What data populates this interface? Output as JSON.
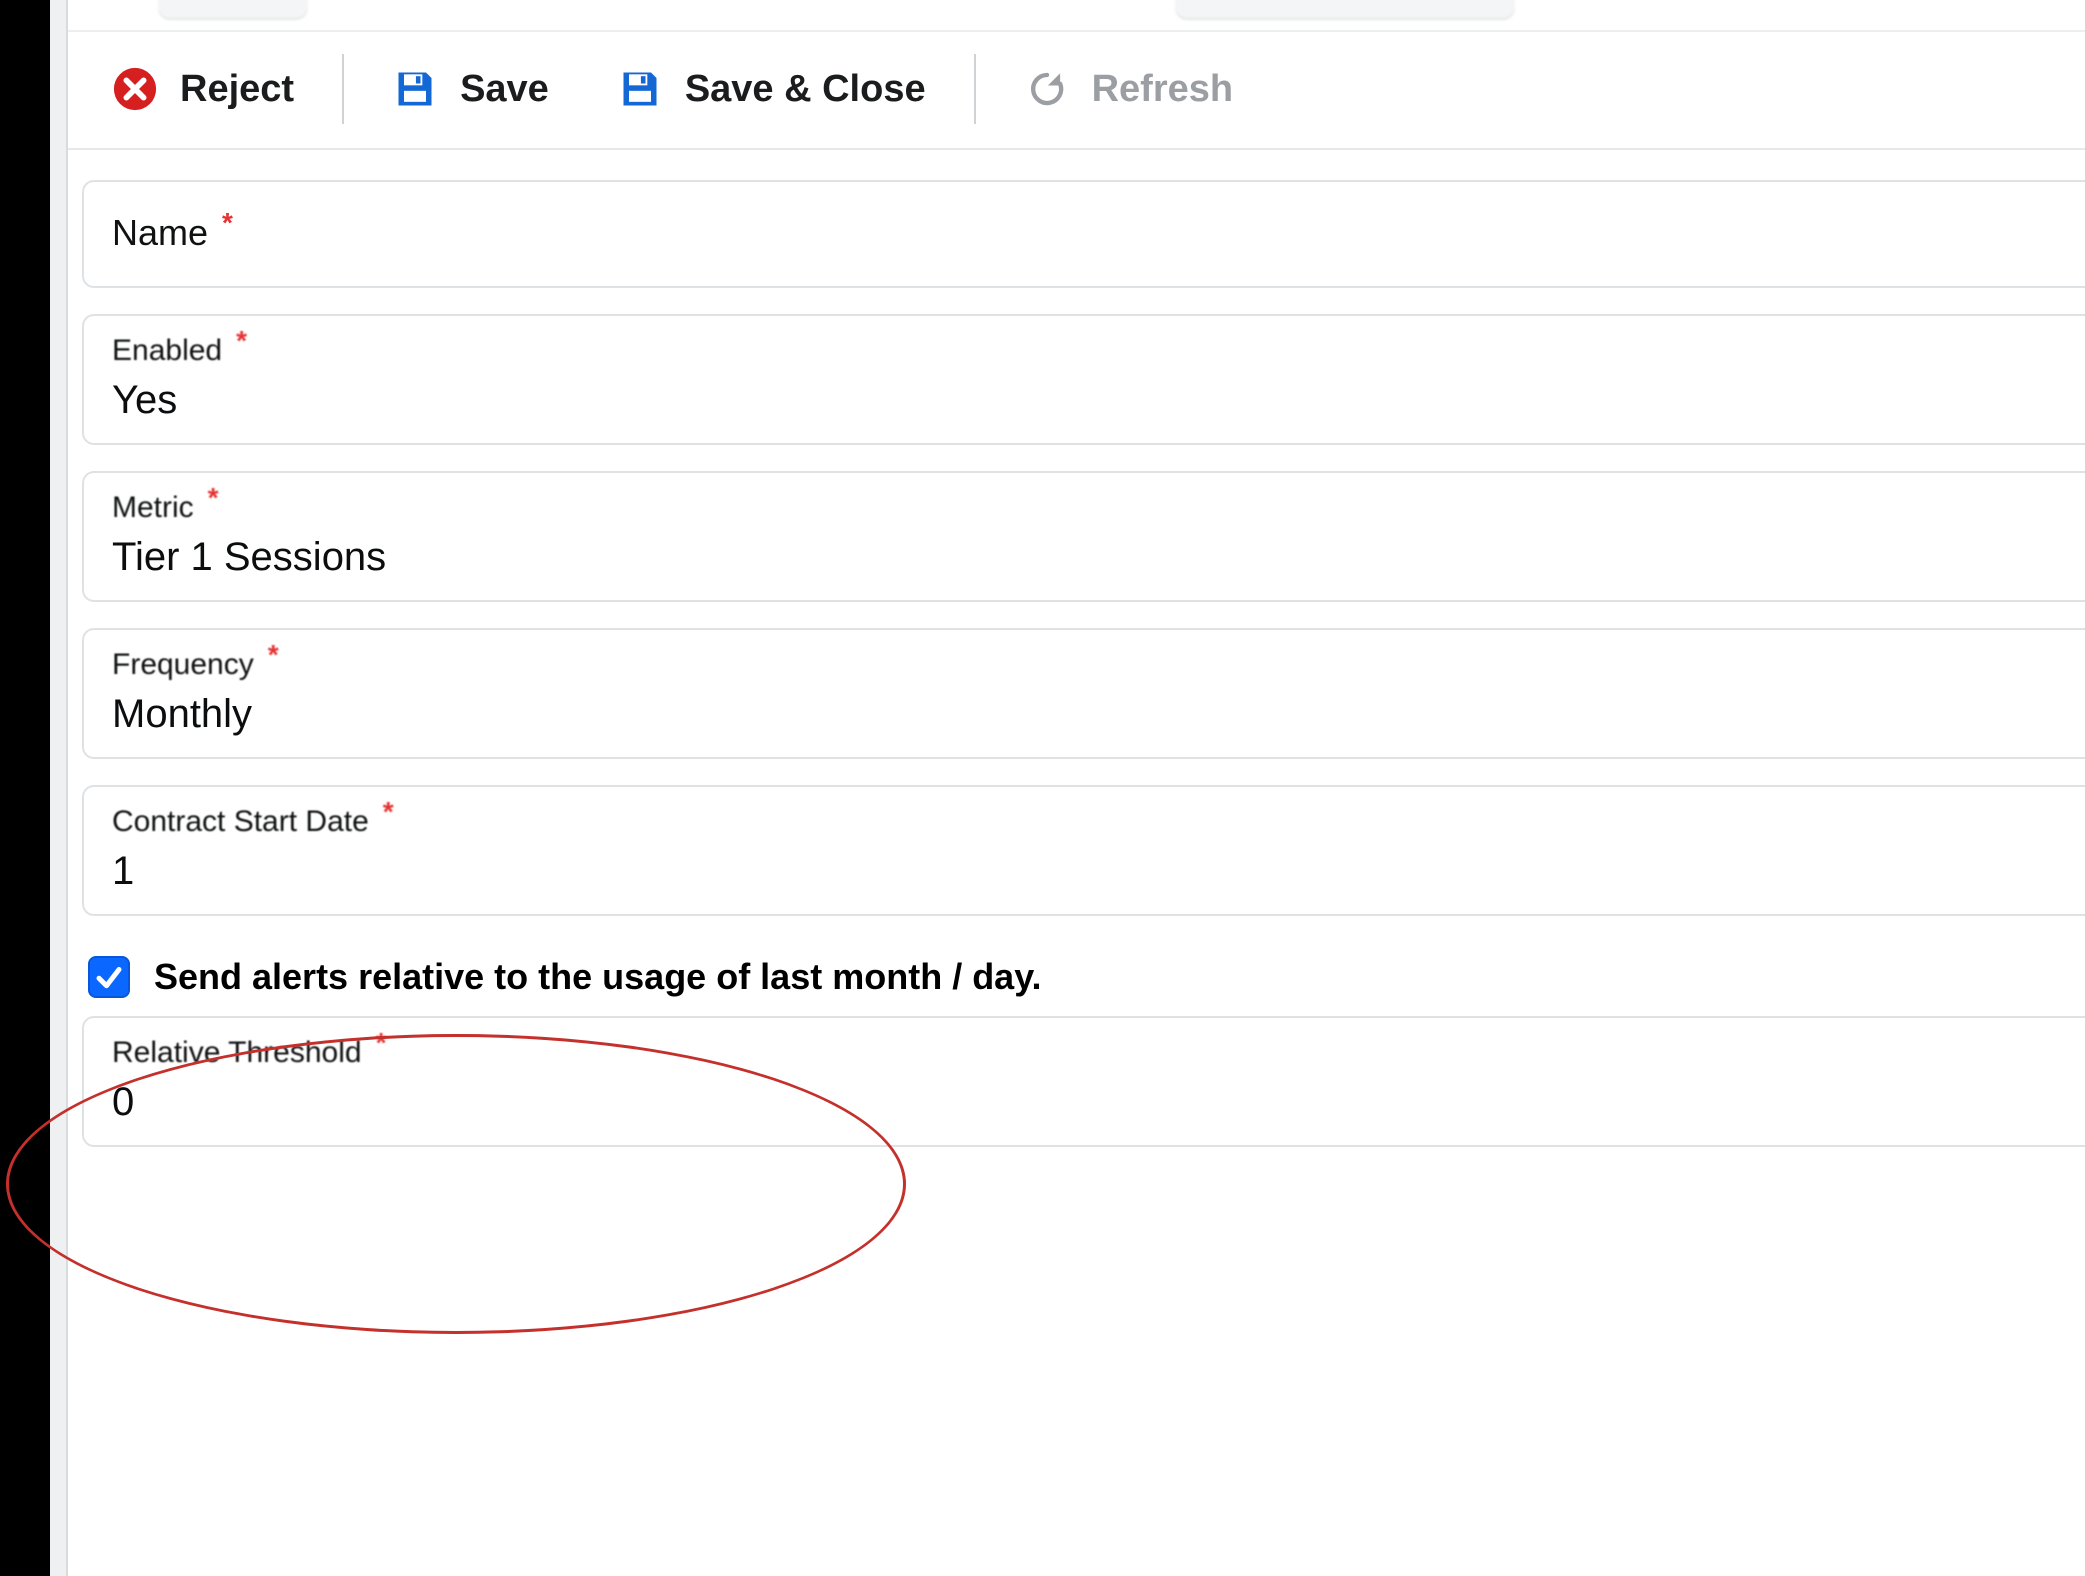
{
  "toolbar": {
    "reject_label": "Reject",
    "save_label": "Save",
    "save_close_label": "Save & Close",
    "refresh_label": "Refresh"
  },
  "fields": {
    "name": {
      "label": "Name",
      "value": ""
    },
    "enabled": {
      "label": "Enabled",
      "value": "Yes"
    },
    "metric": {
      "label": "Metric",
      "value": "Tier 1 Sessions"
    },
    "frequency": {
      "label": "Frequency",
      "value": "Monthly"
    },
    "contract_start": {
      "label": "Contract Start Date",
      "value": "1"
    },
    "relative_threshold": {
      "label": "Relative Threshold",
      "value": "0"
    }
  },
  "checkbox": {
    "checked": true,
    "label": "Send alerts relative to the usage of last month / day."
  },
  "colors": {
    "accent_blue": "#0a67ff",
    "save_icon_blue": "#1368d6",
    "reject_red": "#d6201f"
  }
}
